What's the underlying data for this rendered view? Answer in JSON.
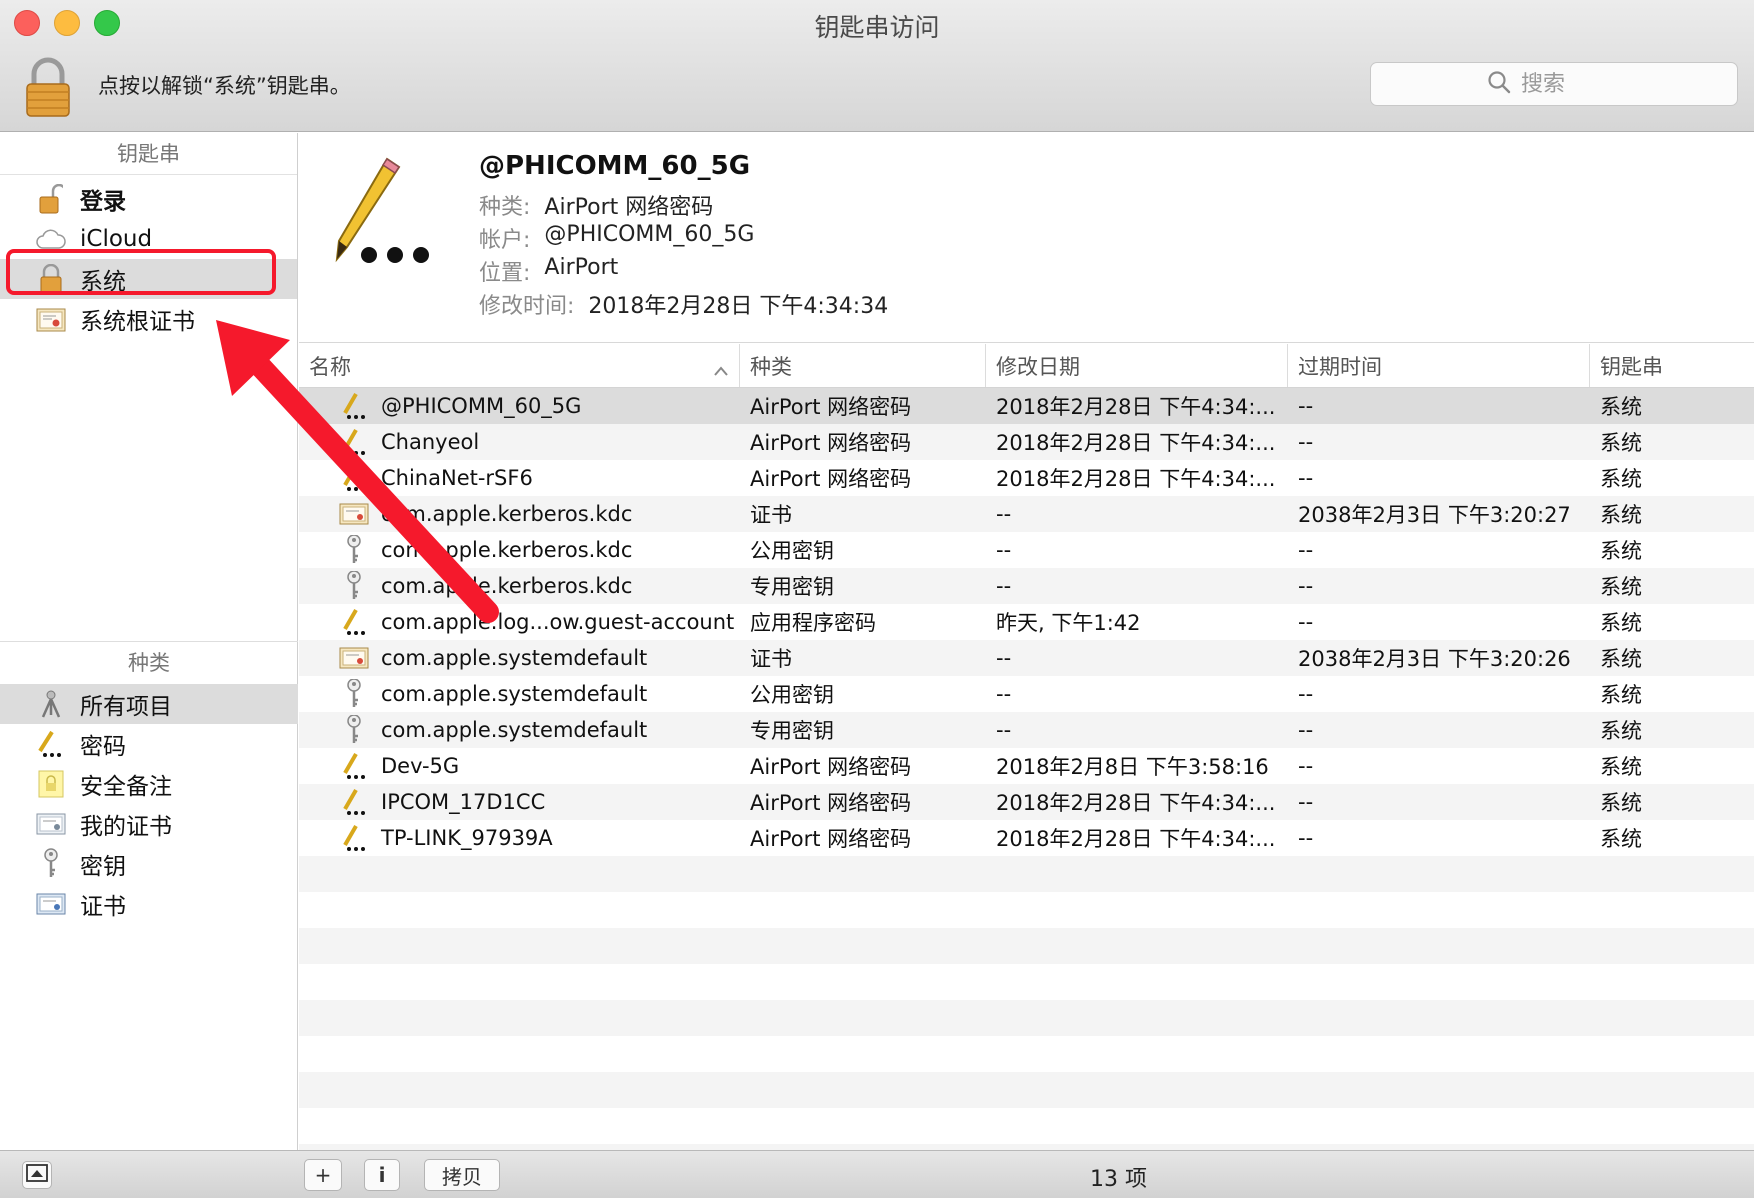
{
  "window": {
    "title": "钥匙串访问"
  },
  "toolbar": {
    "lock_message": "点按以解锁“系统”钥匙串。",
    "search_placeholder": "搜索"
  },
  "sidebar": {
    "keychains_header": "钥匙串",
    "keychains": [
      {
        "label": "登录",
        "icon": "lock-open-icon",
        "bold": true
      },
      {
        "label": "iCloud",
        "icon": "cloud-icon"
      },
      {
        "label": "系统",
        "icon": "lock-icon",
        "selected": true
      },
      {
        "label": "系统根证书",
        "icon": "certificate-folder-icon"
      }
    ],
    "category_header": "种类",
    "categories": [
      {
        "label": "所有项目",
        "icon": "all-items-icon",
        "selected": true
      },
      {
        "label": "密码",
        "icon": "password-icon"
      },
      {
        "label": "安全备注",
        "icon": "secure-note-icon"
      },
      {
        "label": "我的证书",
        "icon": "my-certificate-icon"
      },
      {
        "label": "密钥",
        "icon": "key-icon"
      },
      {
        "label": "证书",
        "icon": "certificate-icon"
      }
    ]
  },
  "detail": {
    "title": "@PHICOMM_60_5G",
    "kind_label": "种类:",
    "kind_value": "AirPort 网络密码",
    "account_label": "帐户:",
    "account_value": "@PHICOMM_60_5G",
    "where_label": "位置:",
    "where_value": "AirPort",
    "modified_label": "修改时间:",
    "modified_value": "2018年2月28日 下午4:34:34"
  },
  "table": {
    "columns": [
      "名称",
      "种类",
      "修改日期",
      "过期时间",
      "钥匙串"
    ],
    "rows": [
      {
        "icon": "password-icon",
        "name": "@PHICOMM_60_5G",
        "kind": "AirPort 网络密码",
        "modified": "2018年2月28日 下午4:34:...",
        "expires": "--",
        "keychain": "系统"
      },
      {
        "icon": "password-icon",
        "name": "Chanyeol",
        "kind": "AirPort 网络密码",
        "modified": "2018年2月28日 下午4:34:...",
        "expires": "--",
        "keychain": "系统"
      },
      {
        "icon": "password-icon",
        "name": "ChinaNet-rSF6",
        "kind": "AirPort 网络密码",
        "modified": "2018年2月28日 下午4:34:...",
        "expires": "--",
        "keychain": "系统"
      },
      {
        "icon": "certificate-icon",
        "name": "com.apple.kerberos.kdc",
        "kind": "证书",
        "modified": "--",
        "expires": "2038年2月3日 下午3:20:27",
        "keychain": "系统"
      },
      {
        "icon": "key-icon",
        "name": "com.apple.kerberos.kdc",
        "kind": "公用密钥",
        "modified": "--",
        "expires": "--",
        "keychain": "系统"
      },
      {
        "icon": "key-icon",
        "name": "com.apple.kerberos.kdc",
        "kind": "专用密钥",
        "modified": "--",
        "expires": "--",
        "keychain": "系统"
      },
      {
        "icon": "password-icon",
        "name": "com.apple.log...ow.guest-account",
        "kind": "应用程序密码",
        "modified": "昨天, 下午1:42",
        "expires": "--",
        "keychain": "系统"
      },
      {
        "icon": "certificate-icon",
        "name": "com.apple.systemdefault",
        "kind": "证书",
        "modified": "--",
        "expires": "2038年2月3日 下午3:20:26",
        "keychain": "系统"
      },
      {
        "icon": "key-icon",
        "name": "com.apple.systemdefault",
        "kind": "公用密钥",
        "modified": "--",
        "expires": "--",
        "keychain": "系统"
      },
      {
        "icon": "key-icon",
        "name": "com.apple.systemdefault",
        "kind": "专用密钥",
        "modified": "--",
        "expires": "--",
        "keychain": "系统"
      },
      {
        "icon": "password-icon",
        "name": "Dev-5G",
        "kind": "AirPort 网络密码",
        "modified": "2018年2月8日 下午3:58:16",
        "expires": "--",
        "keychain": "系统"
      },
      {
        "icon": "password-icon",
        "name": "IPCOM_17D1CC",
        "kind": "AirPort 网络密码",
        "modified": "2018年2月28日 下午4:34:...",
        "expires": "--",
        "keychain": "系统"
      },
      {
        "icon": "password-icon",
        "name": "TP-LINK_97939A",
        "kind": "AirPort 网络密码",
        "modified": "2018年2月28日 下午4:34:...",
        "expires": "--",
        "keychain": "系统"
      }
    ]
  },
  "bottombar": {
    "add_label": "+",
    "info_label": "i",
    "copy_label": "拷贝",
    "count_label": "13 项"
  },
  "colors": {
    "highlight": "#f5192c",
    "selection": "#dcdcdc"
  }
}
